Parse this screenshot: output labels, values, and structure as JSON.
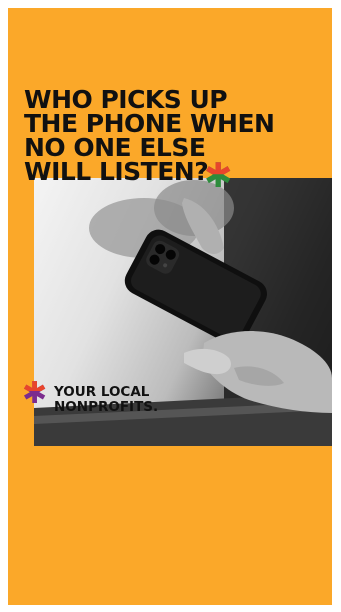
{
  "headline": {
    "lines": [
      "WHO PICKS UP",
      "THE PHONE WHEN",
      "NO ONE ELSE",
      "WILL LISTEN?"
    ]
  },
  "tagline": {
    "lines": [
      "YOUR LOCAL",
      "NONPROFITS."
    ]
  },
  "decor": {
    "asterisk": "✱",
    "headline_star_icon": "asterisk-icon",
    "tagline_star_icon": "asterisk-icon"
  },
  "colors": {
    "background": "#FBA829",
    "text": "#111111",
    "star_green": "#2D8C3C",
    "star_purple": "#7B2C8E",
    "star_red": "#E8452C"
  }
}
